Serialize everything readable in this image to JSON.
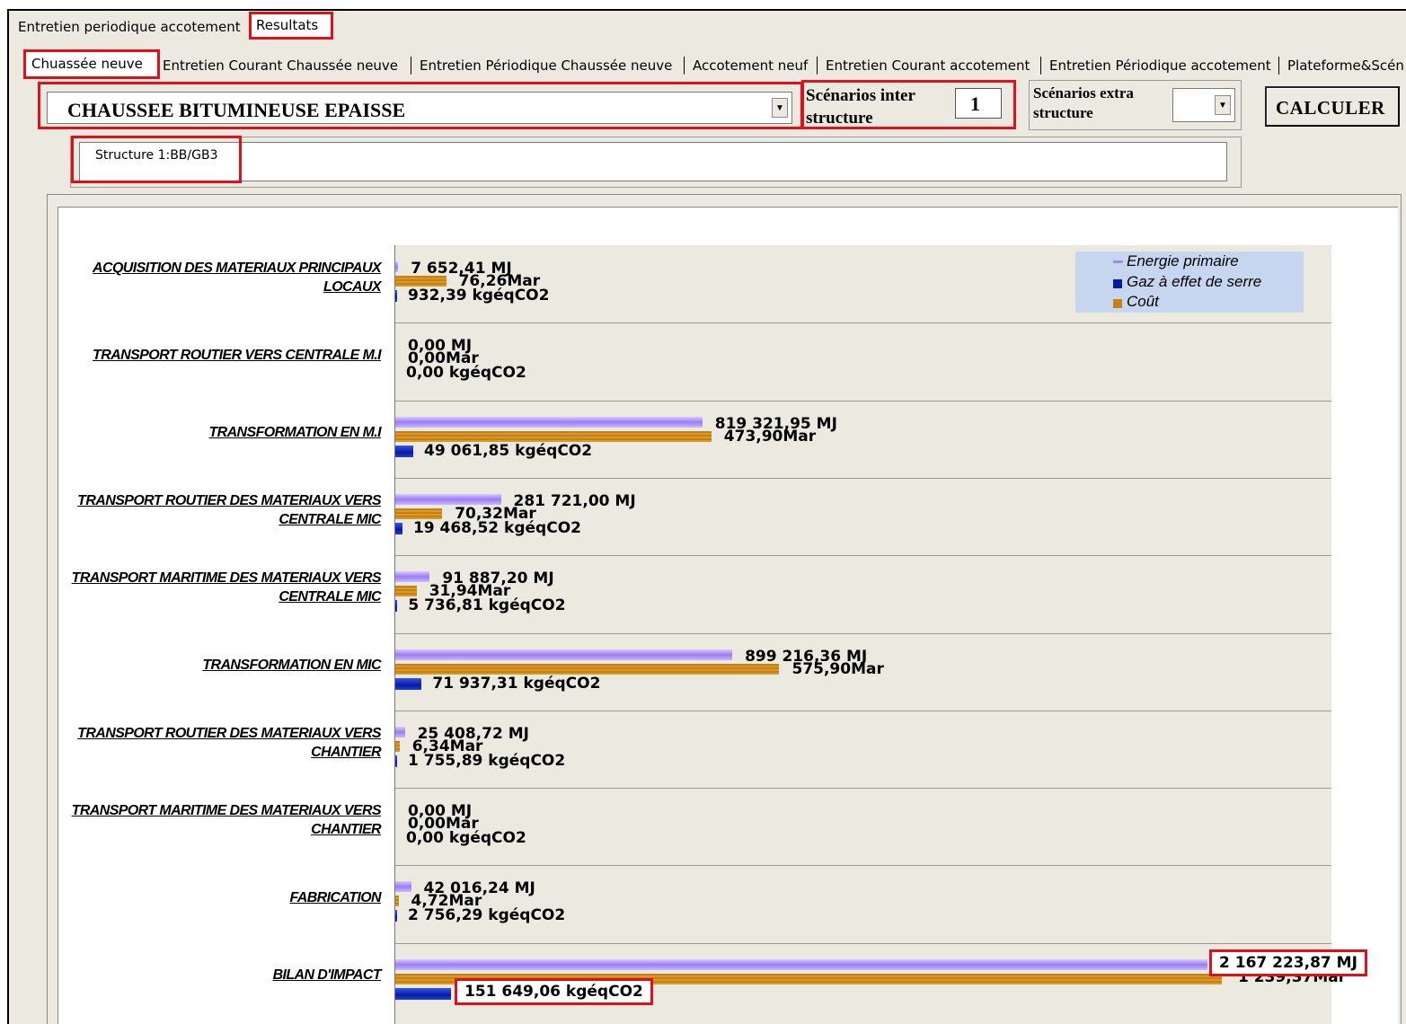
{
  "top_tabs": [
    "Entretien periodique accotement",
    "Resultats"
  ],
  "sub_tabs": [
    "Chuassée neuve",
    "Entretien Courant Chaussée neuve",
    "Entretien Périodique Chaussée neuve",
    "Accotement neuf",
    "Entretien Courant accotement",
    "Entretien Périodique accotement",
    "Plateforme&Scén"
  ],
  "controls": {
    "structure_type": "CHAUSSEE BITUMINEUSE EPAISSE",
    "scenarios_inter_label": "Scénarios inter structure",
    "scenarios_inter_value": "1",
    "scenarios_extra_label": "Scénarios extra structure",
    "scenarios_extra_value": "",
    "calculate_label": "CALCULER",
    "structure_name": "Structure 1:BB/GB3"
  },
  "legend": {
    "energy": "Energie primaire",
    "ghg": "Gaz à effet de serre",
    "cost": "Coût"
  },
  "colors": {
    "energy": "#a48af4",
    "ghg": "#0a1aa0",
    "cost": "#c8800e",
    "highlight": "#e0101a"
  },
  "chart_data": {
    "type": "bar",
    "orientation": "horizontal",
    "legend_position": "top-right",
    "categories": [
      "ACQUISITION DES MATERIAUX PRINCIPAUX LOCAUX",
      "TRANSPORT ROUTIER VERS CENTRALE M.I",
      "TRANSFORMATION EN M.I",
      "TRANSPORT ROUTIER DES MATERIAUX  VERS CENTRALE MIC",
      "TRANSPORT MARITIME DES MATERIAUX VERS CENTRALE MIC",
      "TRANSFORMATION EN MIC",
      "TRANSPORT ROUTIER DES MATERIAUX  VERS CHANTIER",
      "TRANSPORT MARITIME DES MATERIAUX VERS CHANTIER",
      "FABRICATION",
      "BILAN D'IMPACT"
    ],
    "series": [
      {
        "name": "Energie primaire",
        "key": "energy",
        "values": [
          7652.41,
          0,
          819321.95,
          281721.0,
          91887.2,
          899216.36,
          25408.72,
          0,
          42016.24,
          2167223.87
        ],
        "labels": [
          "7 652,41 MJ",
          "0,00 MJ",
          "819 321,95 MJ",
          "281 721,00 MJ",
          "91 887,20 MJ",
          "899 216,36 MJ",
          "25 408,72 MJ",
          "0,00 MJ",
          "42 016,24 MJ",
          "2 167 223,87 MJ"
        ]
      },
      {
        "name": "Coût",
        "key": "cost",
        "values": [
          76.26,
          0,
          473.9,
          70.32,
          31.94,
          575.9,
          6.34,
          0,
          4.72,
          1239.37
        ],
        "labels": [
          "76,26Mar",
          "0,00Mar",
          "473,90Mar",
          "70,32Mar",
          "31,94Mar",
          "575,90Mar",
          "6,34Mar",
          "0,00Mar",
          "4,72Mar",
          "1 239,37Mar"
        ]
      },
      {
        "name": "Gaz à effet de serre",
        "key": "ghg",
        "values": [
          932.39,
          0,
          49061.85,
          19468.52,
          5736.81,
          71937.31,
          1755.89,
          0,
          2756.29,
          151649.06
        ],
        "labels": [
          "932,39 kgéqCO2",
          "0,00 kgéqCO2",
          "49 061,85 kgéqCO2",
          "19 468,52 kgéqCO2",
          "5 736,81 kgéqCO2",
          "71 937,31 kgéqCO2",
          "1 755,89 kgéqCO2",
          "0,00 kgéqCO2",
          "2 756,29 kgéqCO2",
          "151 649,06 kgéqCO2"
        ]
      }
    ]
  }
}
